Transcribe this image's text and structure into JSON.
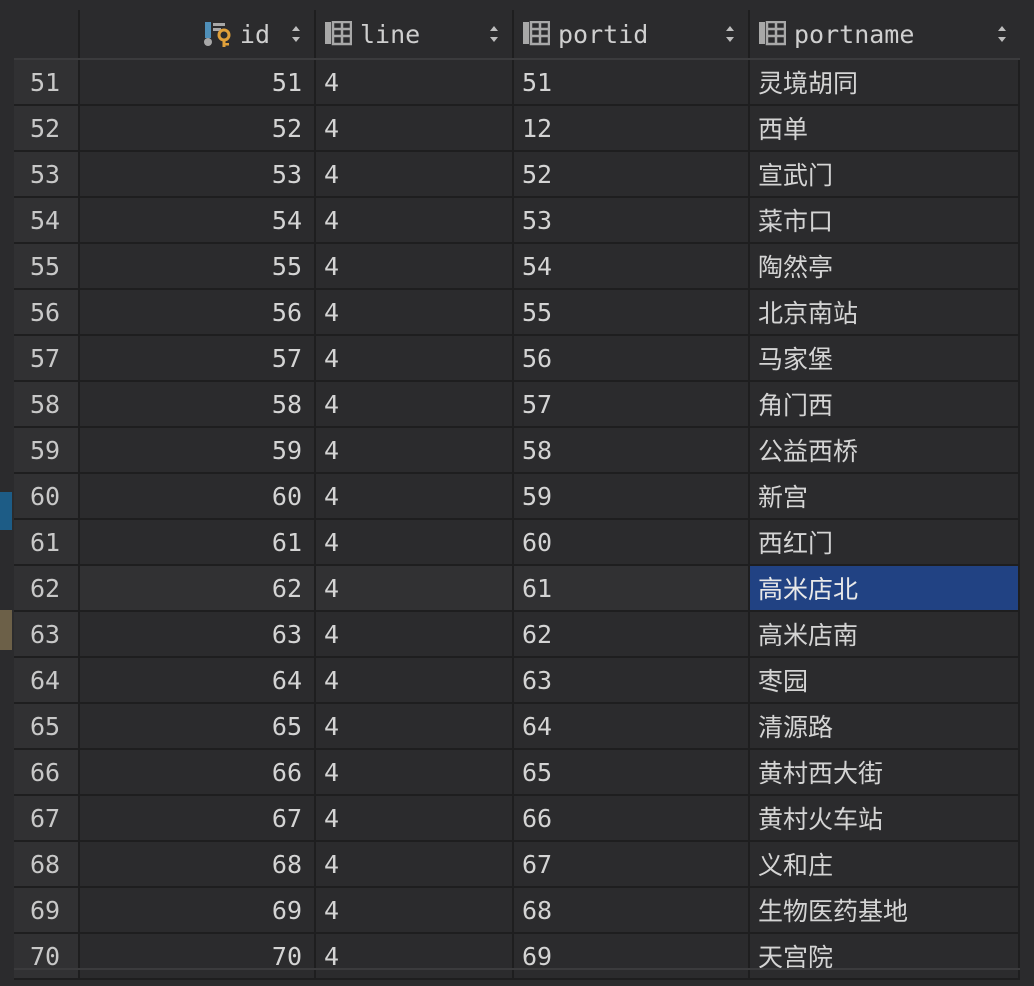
{
  "columns": [
    {
      "key": "rownum",
      "label": ""
    },
    {
      "key": "id",
      "label": "id",
      "icon": "primary-key-column-icon"
    },
    {
      "key": "line",
      "label": "line",
      "icon": "column-icon"
    },
    {
      "key": "portid",
      "label": "portid",
      "icon": "column-icon"
    },
    {
      "key": "portname",
      "label": "portname",
      "icon": "column-icon"
    }
  ],
  "selected": {
    "row": 62,
    "column": "portname"
  },
  "rows": [
    {
      "rownum": "51",
      "id": "51",
      "line": "4",
      "portid": "51",
      "portname": "灵境胡同"
    },
    {
      "rownum": "52",
      "id": "52",
      "line": "4",
      "portid": "12",
      "portname": "西单"
    },
    {
      "rownum": "53",
      "id": "53",
      "line": "4",
      "portid": "52",
      "portname": "宣武门"
    },
    {
      "rownum": "54",
      "id": "54",
      "line": "4",
      "portid": "53",
      "portname": "菜市口"
    },
    {
      "rownum": "55",
      "id": "55",
      "line": "4",
      "portid": "54",
      "portname": "陶然亭"
    },
    {
      "rownum": "56",
      "id": "56",
      "line": "4",
      "portid": "55",
      "portname": "北京南站"
    },
    {
      "rownum": "57",
      "id": "57",
      "line": "4",
      "portid": "56",
      "portname": "马家堡"
    },
    {
      "rownum": "58",
      "id": "58",
      "line": "4",
      "portid": "57",
      "portname": "角门西"
    },
    {
      "rownum": "59",
      "id": "59",
      "line": "4",
      "portid": "58",
      "portname": "公益西桥"
    },
    {
      "rownum": "60",
      "id": "60",
      "line": "4",
      "portid": "59",
      "portname": "新宫"
    },
    {
      "rownum": "61",
      "id": "61",
      "line": "4",
      "portid": "60",
      "portname": "西红门"
    },
    {
      "rownum": "62",
      "id": "62",
      "line": "4",
      "portid": "61",
      "portname": "高米店北"
    },
    {
      "rownum": "63",
      "id": "63",
      "line": "4",
      "portid": "62",
      "portname": "高米店南"
    },
    {
      "rownum": "64",
      "id": "64",
      "line": "4",
      "portid": "63",
      "portname": "枣园"
    },
    {
      "rownum": "65",
      "id": "65",
      "line": "4",
      "portid": "64",
      "portname": "清源路"
    },
    {
      "rownum": "66",
      "id": "66",
      "line": "4",
      "portid": "65",
      "portname": "黄村西大街"
    },
    {
      "rownum": "67",
      "id": "67",
      "line": "4",
      "portid": "66",
      "portname": "黄村火车站"
    },
    {
      "rownum": "68",
      "id": "68",
      "line": "4",
      "portid": "67",
      "portname": "义和庄"
    },
    {
      "rownum": "69",
      "id": "69",
      "line": "4",
      "portid": "68",
      "portname": "生物医药基地"
    },
    {
      "rownum": "70",
      "id": "70",
      "line": "4",
      "portid": "69",
      "portname": "天宫院"
    }
  ],
  "colors": {
    "background": "#2b2b2d",
    "selection": "#214283",
    "key_icon": "#e0a03a",
    "column_icon": "#a8a8a8"
  }
}
